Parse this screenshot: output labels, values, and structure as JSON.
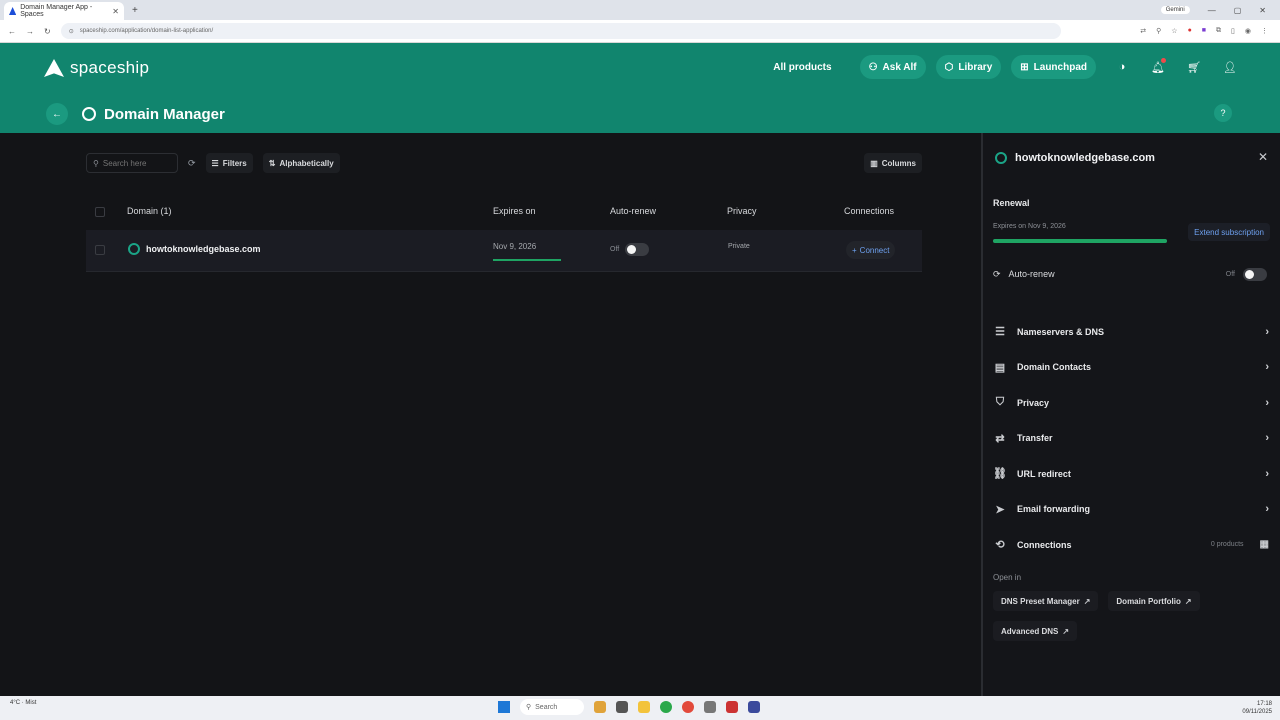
{
  "browser": {
    "tab_title": "Domain Manager App - Spaces",
    "url": "spaceship.com/application/domain-list-application/",
    "profile_chip": "Gemini"
  },
  "header": {
    "logo_text": "spaceship",
    "nav": {
      "all_products": "All products",
      "ask_alf": "Ask Alf",
      "library": "Library",
      "launchpad": "Launchpad"
    },
    "page_title": "Domain Manager"
  },
  "toolbar": {
    "search_placeholder": "Search here",
    "filters": "Filters",
    "sort": "Alphabetically",
    "columns": "Columns"
  },
  "table": {
    "headers": {
      "domain": "Domain (1)",
      "expires": "Expires on",
      "autorenew": "Auto-renew",
      "privacy": "Privacy",
      "connections": "Connections"
    },
    "rows": [
      {
        "domain": "howtoknowledgebase.com",
        "expires": "Nov 9, 2026",
        "expiry_progress": 1.0,
        "autorenew": "Off",
        "privacy": "Private",
        "connect": "Connect"
      }
    ]
  },
  "panel": {
    "domain": "howtoknowledgebase.com",
    "renewal_label": "Renewal",
    "expires_text": "Expires on Nov 9, 2026",
    "renewal_progress": 1.0,
    "extend": "Extend subscription",
    "autorenew_label": "Auto-renew",
    "autorenew_state": "Off",
    "menu": {
      "nameservers": "Nameservers & DNS",
      "contacts": "Domain Contacts",
      "privacy": "Privacy",
      "transfer": "Transfer",
      "url_redirect": "URL redirect",
      "email_forwarding": "Email forwarding",
      "connections": "Connections",
      "connections_count": "0 products"
    },
    "open_in_label": "Open in",
    "links": {
      "dns_preset": "DNS Preset Manager",
      "portfolio": "Domain Portfolio",
      "advanced_dns": "Advanced DNS"
    }
  },
  "taskbar": {
    "weather": "4°C · Mist",
    "search": "Search",
    "time": "17:18",
    "date": "09/11/2025"
  },
  "colors": {
    "brand": "#11856e",
    "accent_green": "#1fa463",
    "link_blue": "#6ea1f0",
    "background": "#131417"
  }
}
